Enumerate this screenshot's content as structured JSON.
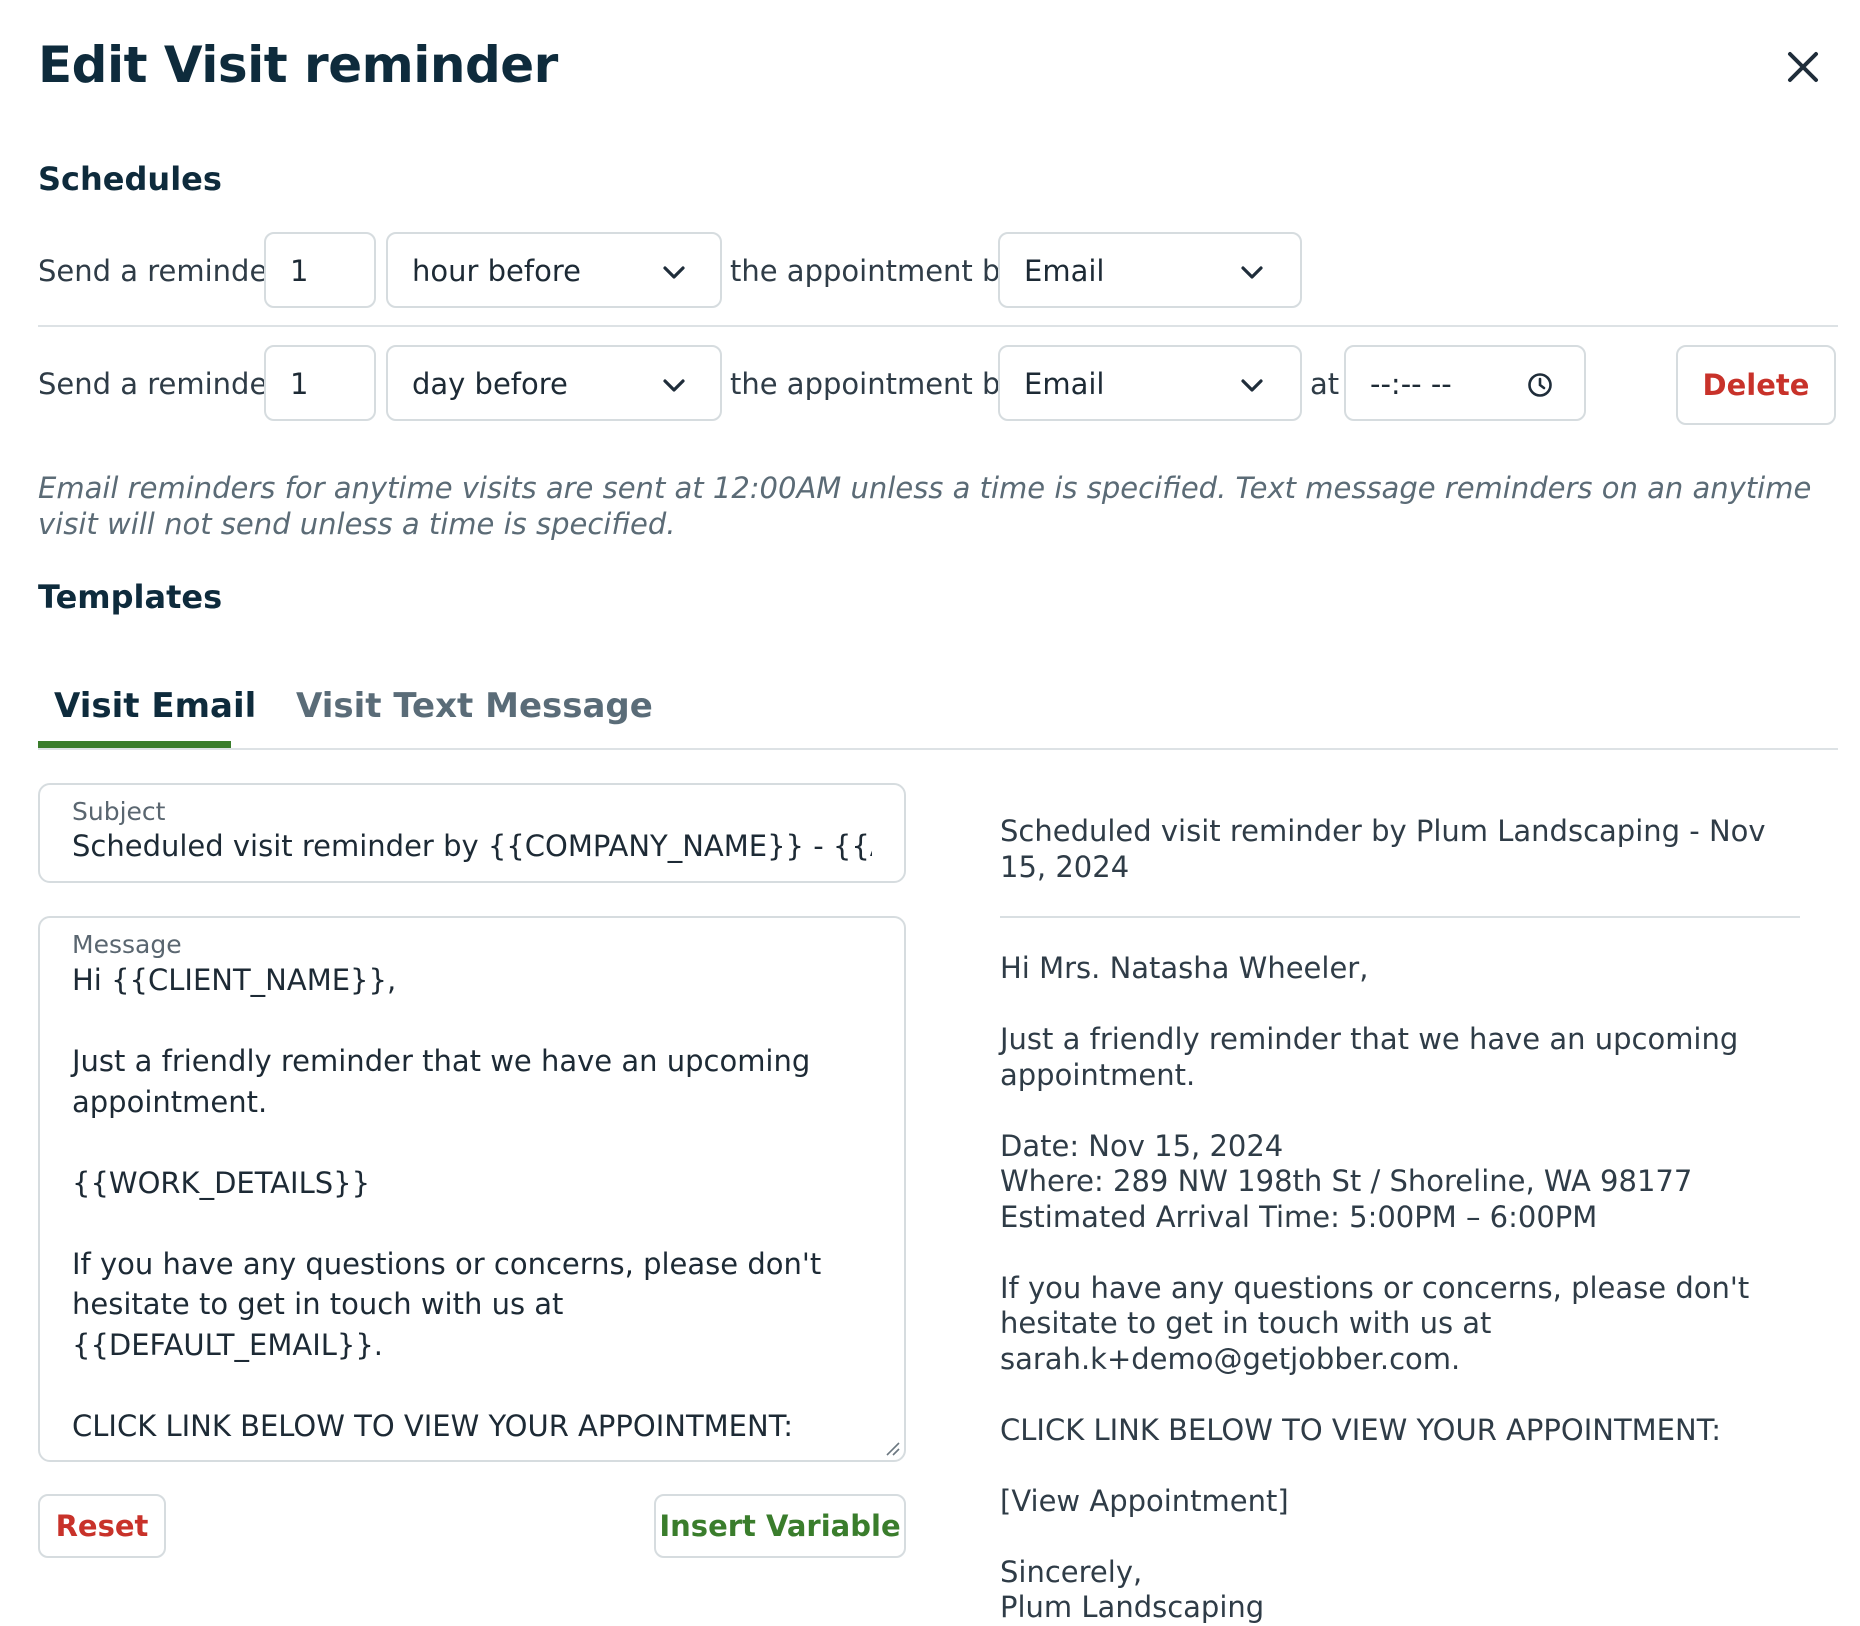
{
  "dialog": {
    "title": "Edit Visit reminder"
  },
  "schedules": {
    "heading": "Schedules",
    "rows": [
      {
        "prefix": "Send a reminder",
        "amount": "1",
        "unit": "hour before",
        "middle": "the appointment by",
        "method": "Email"
      },
      {
        "prefix": "Send a reminder",
        "amount": "1",
        "unit": "day before",
        "middle": "the appointment by",
        "method": "Email",
        "at_label": "at",
        "time_value": "--:-- --",
        "delete_label": "Delete"
      }
    ],
    "note": "Email reminders for anytime visits are sent at 12:00AM unless a time is specified. Text message reminders on an anytime visit will not send unless a time is specified."
  },
  "templates": {
    "heading": "Templates",
    "tabs": [
      {
        "label": "Visit Email",
        "active": true
      },
      {
        "label": "Visit Text Message",
        "active": false
      }
    ],
    "subject": {
      "label": "Subject",
      "value": "Scheduled visit reminder by {{COMPANY_NAME}} - {{APPOINTMENT_DATE}}"
    },
    "message": {
      "label": "Message",
      "value": "Hi {{CLIENT_NAME}},\n\nJust a friendly reminder that we have an upcoming appointment.\n\n{{WORK_DETAILS}}\n\nIf you have any questions or concerns, please don't hesitate to get in touch with us at {{DEFAULT_EMAIL}}.\n\nCLICK LINK BELOW TO VIEW YOUR APPOINTMENT:\n\n{{VISIT_CONFIRMATION_LINK}}"
    },
    "reset_label": "Reset",
    "insert_variable_label": "Insert Variable"
  },
  "preview": {
    "subject": "Scheduled visit reminder by Plum Landscaping - Nov 15, 2024",
    "body": "Hi Mrs. Natasha Wheeler,\n\nJust a friendly reminder that we have an upcoming appointment.\n\nDate: Nov 15, 2024\nWhere: 289 NW 198th St / Shoreline, WA 98177\nEstimated Arrival Time: 5:00PM – 6:00PM\n\nIf you have any questions or concerns, please don't hesitate to get in touch with us at sarah.k+demo@getjobber.com.\n\nCLICK LINK BELOW TO VIEW YOUR APPOINTMENT:\n\n[View Appointment]\n\nSincerely,\nPlum Landscaping"
  },
  "colors": {
    "accent_green": "#3a7d2c",
    "danger_red": "#c8322a",
    "heading": "#0e2b3c",
    "border": "#d6dcdf"
  },
  "icons": [
    "close-icon",
    "chevron-down-icon",
    "clock-icon"
  ]
}
